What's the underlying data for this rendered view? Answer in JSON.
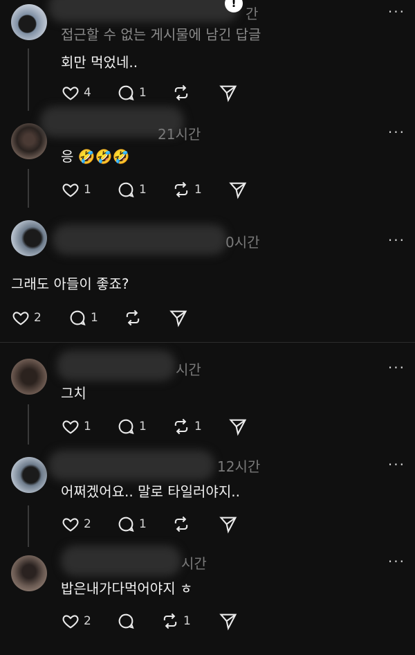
{
  "colors": {
    "background": "#101010",
    "text": "#f1f1f1",
    "muted": "#8a8a8a"
  },
  "more_label": "···",
  "posts": [
    {
      "time": "간",
      "sub": "접근할 수 없는 게시물에 남긴 답글",
      "text": "회만 먹었네..",
      "likes": "4",
      "replies": "1",
      "reposts": ""
    },
    {
      "time": "21시간",
      "sub": "",
      "text": "응 🤣🤣🤣",
      "likes": "1",
      "replies": "1",
      "reposts": "1"
    },
    {
      "time": "0시간",
      "sub": "",
      "text": "그래도 아들이 좋죠?",
      "likes": "2",
      "replies": "1",
      "reposts": ""
    },
    {
      "time": "시간",
      "sub": "",
      "text": "그치",
      "likes": "1",
      "replies": "1",
      "reposts": "1"
    },
    {
      "time": "12시간",
      "sub": "",
      "text": "어쩌겠어요.. 말로 타일러야지..",
      "likes": "2",
      "replies": "1",
      "reposts": ""
    },
    {
      "time": "시간",
      "sub": "",
      "text": "밥은내가다먹어야지 ㅎ",
      "likes": "2",
      "replies": "",
      "reposts": "1"
    }
  ]
}
